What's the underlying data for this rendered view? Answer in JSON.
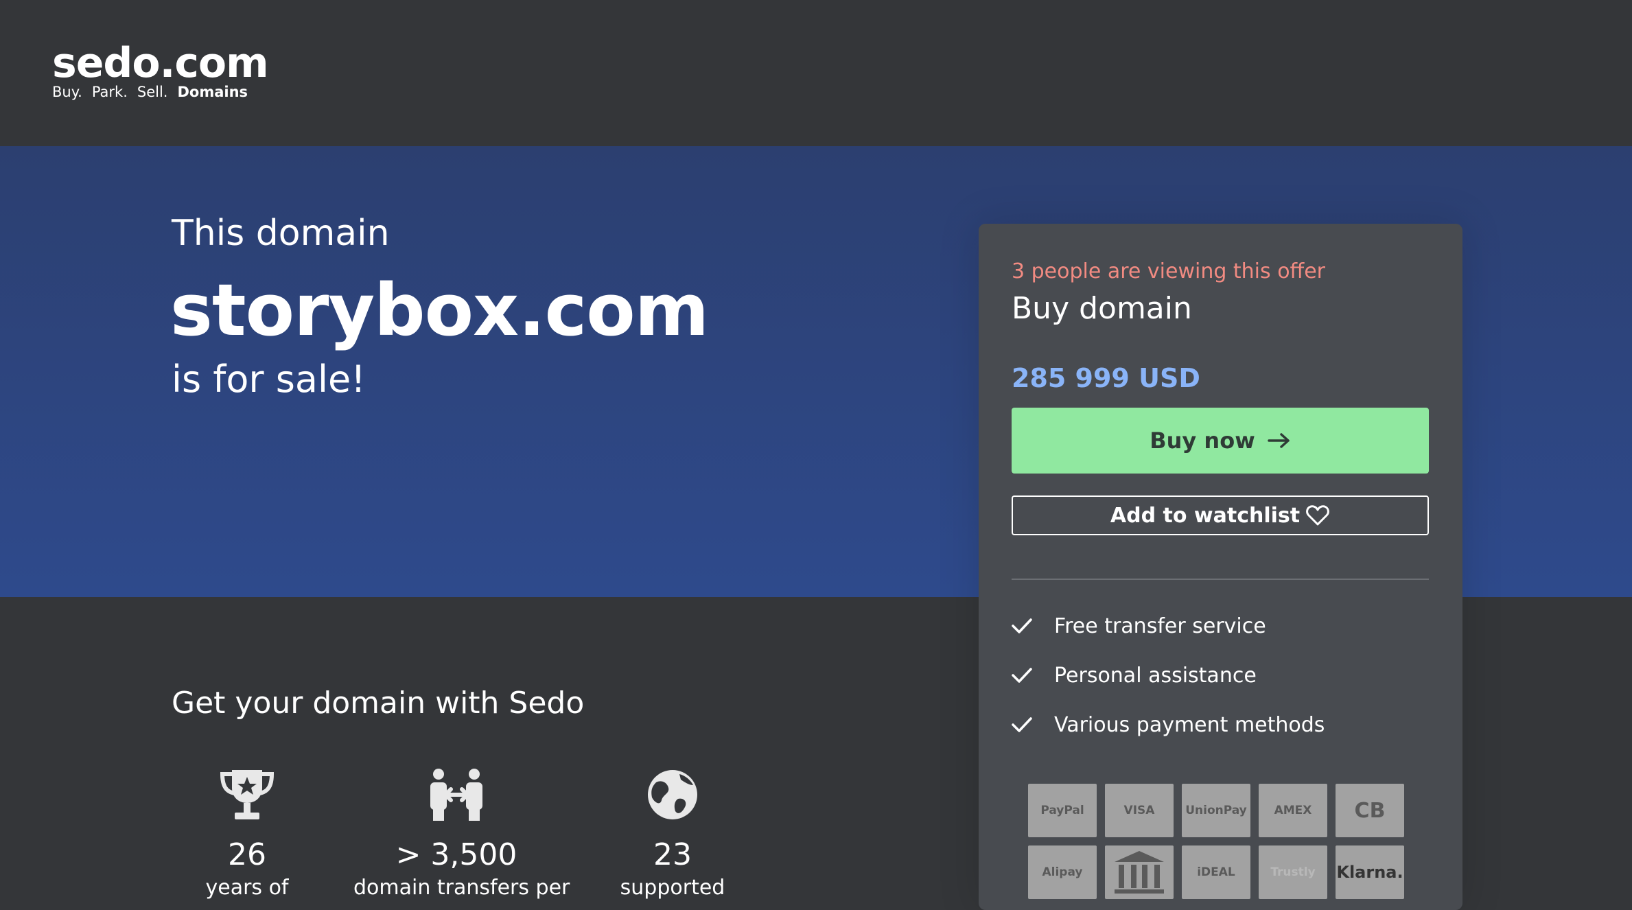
{
  "brand": {
    "name": "sedo.com",
    "tagline": [
      "Buy.",
      "Park.",
      "Sell."
    ],
    "tagline_strong": "Domains"
  },
  "hero": {
    "pre": "This domain",
    "domain": "storybox.com",
    "post": "is for sale!"
  },
  "section_title": "Get your domain with Sedo",
  "stats": [
    {
      "icon": "trophy-icon",
      "value": "26",
      "label": "years of"
    },
    {
      "icon": "transfer-icon",
      "value": "> 3,500",
      "label": "domain transfers per"
    },
    {
      "icon": "globe-icon",
      "value": "23",
      "label": "supported"
    }
  ],
  "offer": {
    "viewers": "3 people are viewing this offer",
    "title": "Buy domain",
    "price": "285 999 USD",
    "buy_label": "Buy now",
    "watchlist_label": "Add to watchlist",
    "features": [
      "Free transfer service",
      "Personal assistance",
      "Various payment methods"
    ],
    "payments": [
      "PayPal",
      "VISA",
      "UnionPay",
      "AMEX",
      "CB",
      "Alipay",
      "Bank",
      "iDEAL",
      "Trustly",
      "Klarna."
    ]
  },
  "colors": {
    "background": "#343639",
    "hero_gradient_top": "#2c3f70",
    "hero_gradient_bottom": "#2e4a8c",
    "card": "#484b50",
    "viewers_text": "#f28b82",
    "price_text": "#8ab4f8",
    "buy_button": "#90e8a0"
  }
}
